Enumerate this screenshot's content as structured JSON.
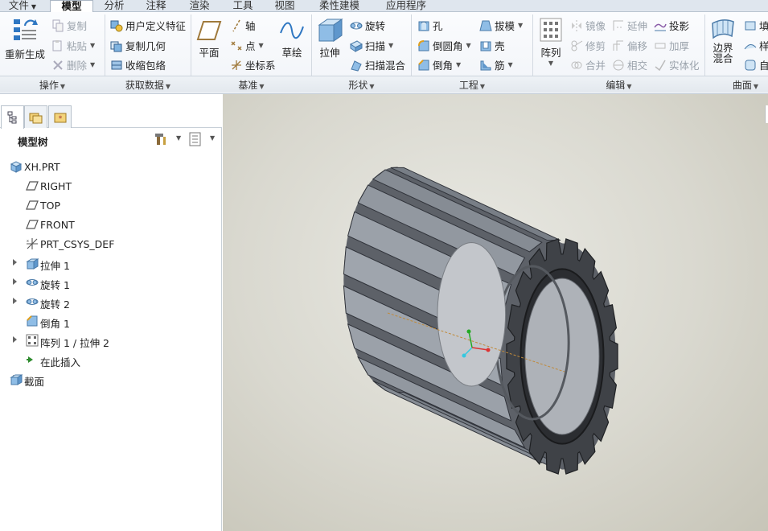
{
  "menu": {
    "file": "文件",
    "tabs": [
      "模型",
      "分析",
      "注释",
      "渲染",
      "工具",
      "视图",
      "柔性建模",
      "应用程序"
    ],
    "active_tab": "模型"
  },
  "ribbon": {
    "operations": {
      "regen": "重新生成",
      "copy": "复制",
      "paste": "粘贴",
      "delete": "删除",
      "label": "操作"
    },
    "get_data": {
      "udf": "用户定义特征",
      "copy_geom": "复制几何",
      "shrinkwrap": "收缩包络",
      "label": "获取数据"
    },
    "datum": {
      "plane": "平面",
      "axis": "轴",
      "point": "点",
      "csys": "坐标系",
      "sketch": "草绘",
      "label": "基准"
    },
    "shapes": {
      "extrude": "拉伸",
      "revolve": "旋转",
      "sweep": "扫描",
      "swept_blend": "扫描混合",
      "label": "形状"
    },
    "engineering": {
      "hole": "孔",
      "round": "倒圆角",
      "chamfer": "倒角",
      "draft": "拔模",
      "shell": "壳",
      "rib": "筋",
      "label": "工程"
    },
    "editing": {
      "pattern": "阵列",
      "mirror": "镜像",
      "trim": "修剪",
      "merge": "合并",
      "extend": "延伸",
      "offset": "偏移",
      "intersect": "相交",
      "project": "投影",
      "thicken": "加厚",
      "solidify": "实体化",
      "label": "编辑"
    },
    "surfaces": {
      "boundary_blend_1": "边界",
      "boundary_blend_2": "混合",
      "fill": "填",
      "style": "样",
      "freestyle": "自",
      "label": "曲面"
    }
  },
  "panel": {
    "title": "模型树",
    "tree": [
      {
        "label": "XH.PRT",
        "icon": "part-icon",
        "expandable": false,
        "indent": 0
      },
      {
        "label": "RIGHT",
        "icon": "datum-plane-icon",
        "expandable": false,
        "indent": 1
      },
      {
        "label": "TOP",
        "icon": "datum-plane-icon",
        "expandable": false,
        "indent": 1
      },
      {
        "label": "FRONT",
        "icon": "datum-plane-icon",
        "expandable": false,
        "indent": 1
      },
      {
        "label": "PRT_CSYS_DEF",
        "icon": "csys-icon",
        "expandable": false,
        "indent": 1
      },
      {
        "label": "拉伸 1",
        "icon": "extrude-icon",
        "expandable": true,
        "indent": 1
      },
      {
        "label": "旋转 1",
        "icon": "revolve-icon",
        "expandable": true,
        "indent": 1
      },
      {
        "label": "旋转 2",
        "icon": "revolve-icon",
        "expandable": true,
        "indent": 1
      },
      {
        "label": "倒角 1",
        "icon": "chamfer-icon",
        "expandable": false,
        "indent": 1
      },
      {
        "label": "阵列 1 / 拉伸 2",
        "icon": "pattern-icon",
        "expandable": true,
        "indent": 1
      },
      {
        "label": "在此插入",
        "icon": "insert-here-icon",
        "expandable": false,
        "indent": 1
      },
      {
        "label": "截面",
        "icon": "section-icon",
        "expandable": true,
        "indent": 0
      }
    ]
  },
  "colors": {
    "accent": "#1e6fbf",
    "model_dark": "#3d4044",
    "model_light": "#8a9099",
    "viewport_bg": "#dcdbd2"
  }
}
